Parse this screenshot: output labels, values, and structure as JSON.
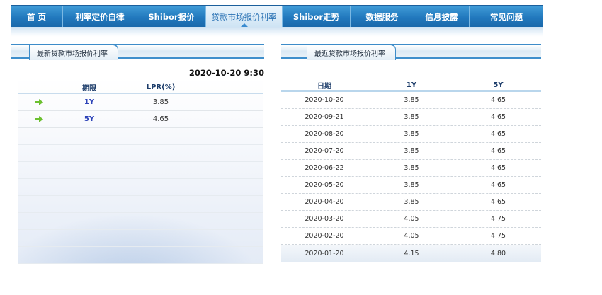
{
  "nav": {
    "items": [
      {
        "label": "首 页",
        "active": false
      },
      {
        "label": "利率定价自律",
        "active": false
      },
      {
        "label": "Shibor报价",
        "active": false
      },
      {
        "label": "贷款市场报价利率",
        "active": true
      },
      {
        "label": "Shibor走势",
        "active": false
      },
      {
        "label": "数据服务",
        "active": false
      },
      {
        "label": "信息披露",
        "active": false
      },
      {
        "label": "常见问题",
        "active": false
      }
    ]
  },
  "latest": {
    "title": "最新贷款市场报价利率",
    "timestamp": "2020-10-20 9:30",
    "columns": {
      "period": "期限",
      "lpr": "LPR(%)"
    },
    "rows": [
      {
        "period": "1Y",
        "lpr": "3.85",
        "icon": "green-arrow-icon"
      },
      {
        "period": "5Y",
        "lpr": "4.65",
        "icon": "green-arrow-icon"
      }
    ]
  },
  "recent": {
    "title": "最近贷款市场报价利率",
    "columns": {
      "date": "日期",
      "y1": "1Y",
      "y5": "5Y"
    },
    "rows": [
      {
        "date": "2020-10-20",
        "y1": "3.85",
        "y5": "4.65"
      },
      {
        "date": "2020-09-21",
        "y1": "3.85",
        "y5": "4.65"
      },
      {
        "date": "2020-08-20",
        "y1": "3.85",
        "y5": "4.65"
      },
      {
        "date": "2020-07-20",
        "y1": "3.85",
        "y5": "4.65"
      },
      {
        "date": "2020-06-22",
        "y1": "3.85",
        "y5": "4.65"
      },
      {
        "date": "2020-05-20",
        "y1": "3.85",
        "y5": "4.65"
      },
      {
        "date": "2020-04-20",
        "y1": "3.85",
        "y5": "4.65"
      },
      {
        "date": "2020-03-20",
        "y1": "4.05",
        "y5": "4.75"
      },
      {
        "date": "2020-02-20",
        "y1": "4.05",
        "y5": "4.75"
      },
      {
        "date": "2020-01-20",
        "y1": "4.15",
        "y5": "4.80"
      }
    ]
  },
  "colors": {
    "nav_blue": "#2178bd",
    "accent_blue": "#3d8cc9",
    "period_blue": "#2d43b8",
    "arrow_green": "#6cc030"
  }
}
